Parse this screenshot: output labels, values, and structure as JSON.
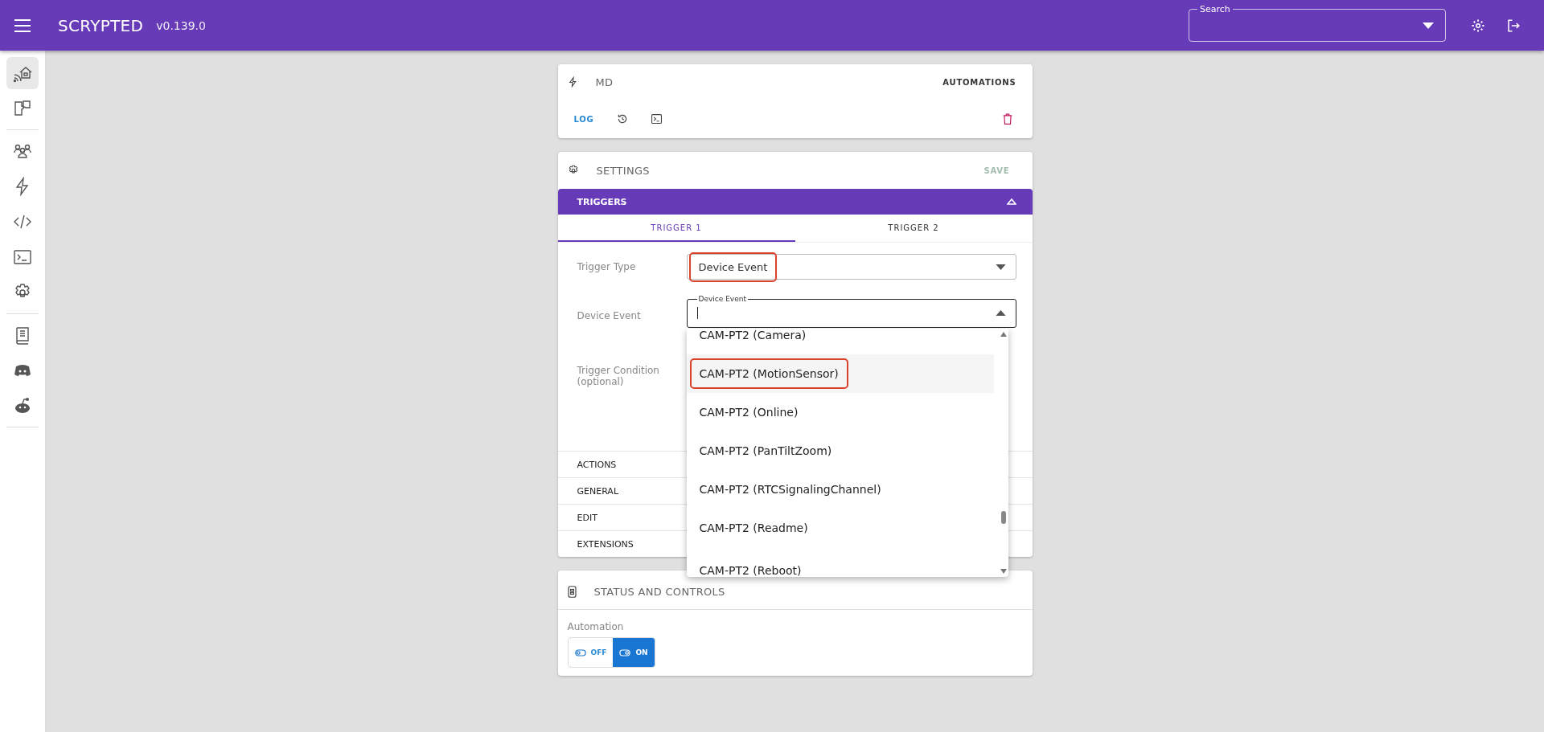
{
  "header": {
    "title": "SCRYPTED",
    "version": "v0.139.0",
    "search": {
      "label": "Search"
    }
  },
  "sidebar": {
    "groups": [
      {
        "items": [
          {
            "selected": true
          },
          {
            "selected": false
          }
        ]
      },
      {
        "items": [
          {
            "selected": false
          },
          {
            "selected": false
          },
          {
            "selected": false
          },
          {
            "selected": false
          },
          {
            "selected": false
          }
        ]
      },
      {
        "items": [
          {
            "selected": false
          },
          {
            "selected": false
          },
          {
            "selected": false
          }
        ]
      }
    ]
  },
  "device_card": {
    "name": "MD",
    "type_link": "AUTOMATIONS",
    "log_label": "LOG"
  },
  "settings": {
    "title": "SETTINGS",
    "save": {
      "label": "SAVE",
      "disabled": true
    },
    "sections": [
      {
        "title": "TRIGGERS",
        "expanded": true,
        "tabs": [
          {
            "label": "TRIGGER 1",
            "selected": true
          },
          {
            "label": "TRIGGER 2",
            "selected": false
          }
        ],
        "fields": [
          {
            "kind": "select",
            "label": "Trigger Type",
            "value": "Device Event",
            "annotated": true
          },
          {
            "kind": "combobox",
            "label": "Device Event",
            "floating_label": "Device Event",
            "open": true,
            "options": [
              {
                "label": "CAM-PT2 (Camera)",
                "highlighted": false,
                "annotated": false
              },
              {
                "label": "CAM-PT2 (MotionSensor)",
                "highlighted": true,
                "annotated": true
              },
              {
                "label": "CAM-PT2 (Online)",
                "highlighted": false,
                "annotated": false
              },
              {
                "label": "CAM-PT2 (PanTiltZoom)",
                "highlighted": false,
                "annotated": false
              },
              {
                "label": "CAM-PT2 (RTCSignalingChannel)",
                "highlighted": false,
                "annotated": false
              },
              {
                "label": "CAM-PT2 (Readme)",
                "highlighted": false,
                "annotated": false
              },
              {
                "label": "CAM-PT2 (Reboot)",
                "highlighted": false,
                "annotated": false
              }
            ]
          },
          {
            "kind": "text",
            "label": "Trigger Condition (optional)"
          }
        ]
      },
      {
        "title": "ACTIONS",
        "expanded": false
      },
      {
        "title": "GENERAL",
        "expanded": false
      },
      {
        "title": "EDIT",
        "expanded": false
      },
      {
        "title": "EXTENSIONS",
        "expanded": false
      }
    ]
  },
  "status": {
    "title": "STATUS AND CONTROLS",
    "controls": [
      {
        "kind": "toggle",
        "label": "Automation",
        "options": [
          {
            "label": "OFF",
            "selected": false
          },
          {
            "label": "ON",
            "selected": true
          }
        ]
      }
    ]
  }
}
